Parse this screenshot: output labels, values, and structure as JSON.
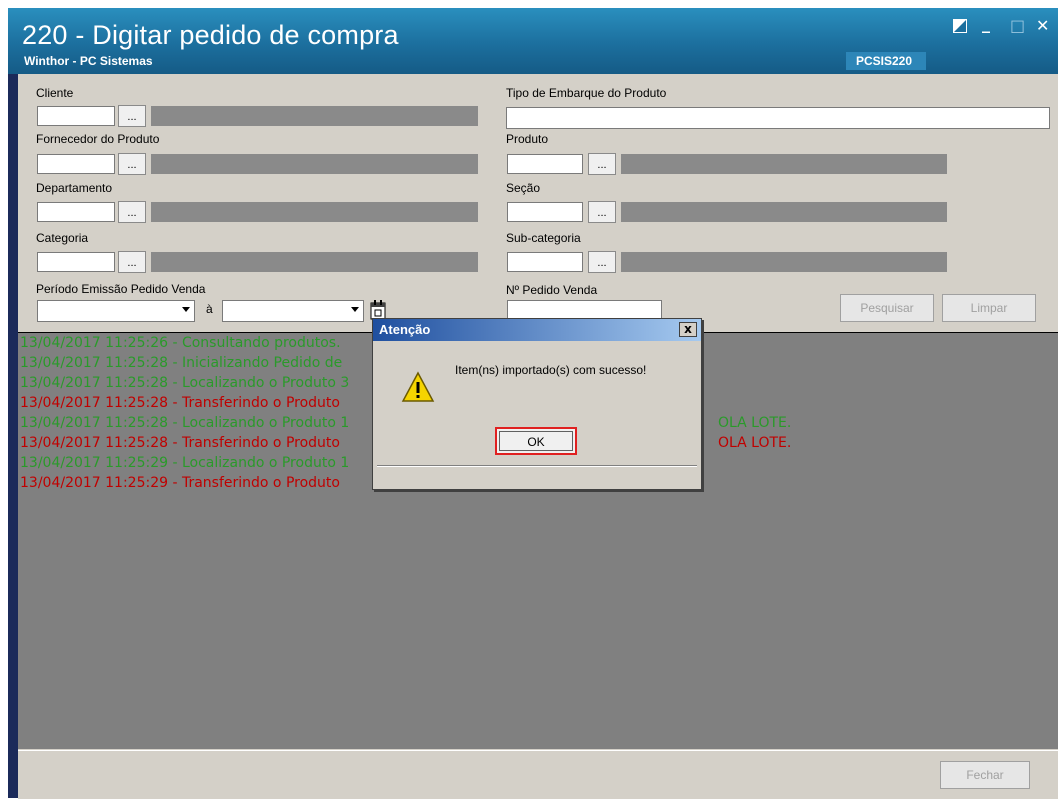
{
  "window": {
    "title": "220 - Digitar pedido de compra",
    "subtitle": "Winthor - PC Sistemas",
    "code": "PCSIS220",
    "minimize": "_",
    "maximize": "□",
    "close": "✕"
  },
  "form": {
    "cliente_label": "Cliente",
    "fornecedor_label": "Fornecedor do Produto",
    "departamento_label": "Departamento",
    "categoria_label": "Categoria",
    "periodo_label": "Período Emissão Pedido Venda",
    "periodo_sep": "à",
    "tipo_embarque_label": "Tipo de Embarque do Produto",
    "produto_label": "Produto",
    "secao_label": "Seção",
    "subcategoria_label": "Sub-categoria",
    "pedido_venda_label": "Nº Pedido Venda",
    "lookup": "..."
  },
  "buttons": {
    "pesquisar": "Pesquisar",
    "limpar": "Limpar",
    "fechar": "Fechar"
  },
  "log": [
    {
      "text": "13/04/2017 11:25:26 - Consultando produtos.",
      "color": "#2a9a2a"
    },
    {
      "text": "13/04/2017 11:25:28 - Inicializando Pedido de",
      "color": "#2a9a2a"
    },
    {
      "text": "13/04/2017 11:25:28 - Localizando o Produto 3",
      "color": "#2a9a2a"
    },
    {
      "text": "13/04/2017 11:25:28 - Transferindo o Produto",
      "color": "#c00000"
    },
    {
      "text": "13/04/2017 11:25:28 - Localizando o Produto 1",
      "color": "#2a9a2a"
    },
    {
      "text": "13/04/2017 11:25:28 - Transferindo o Produto",
      "color": "#c00000"
    },
    {
      "text": "13/04/2017 11:25:29 - Localizando o Produto 1",
      "color": "#2a9a2a"
    },
    {
      "text": "13/04/2017 11:25:29 - Transferindo o Produto",
      "color": "#c00000"
    }
  ],
  "log_tail": {
    "line5": "OLA LOTE.",
    "line6": "OLA LOTE."
  },
  "dialog": {
    "title": "Atenção",
    "message": "Item(ns) importado(s) com sucesso!",
    "ok": "OK",
    "close": "x"
  }
}
